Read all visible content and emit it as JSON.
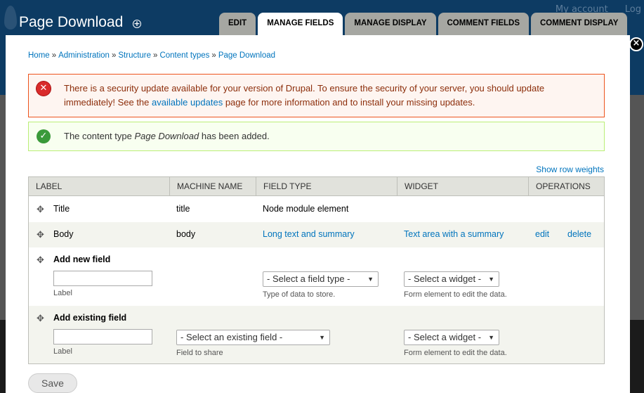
{
  "window": {
    "title": "Page Download",
    "top_links": [
      "My account",
      "Log"
    ]
  },
  "tabs": [
    {
      "label": "EDIT",
      "active": false
    },
    {
      "label": "MANAGE FIELDS",
      "active": true
    },
    {
      "label": "MANAGE DISPLAY",
      "active": false
    },
    {
      "label": "COMMENT FIELDS",
      "active": false
    },
    {
      "label": "COMMENT DISPLAY",
      "active": false
    }
  ],
  "breadcrumb": [
    "Home",
    "Administration",
    "Structure",
    "Content types",
    "Page Download"
  ],
  "messages": {
    "error": {
      "text_before": "There is a security update available for your version of Drupal. To ensure the security of your server, you should update immediately! See the ",
      "link": "available updates",
      "text_after": " page for more information and to install your missing updates."
    },
    "status": {
      "text_before": "The content type ",
      "emphasis": "Page Download",
      "text_after": " has been added."
    }
  },
  "show_row_weights": "Show row weights",
  "table": {
    "headers": [
      "LABEL",
      "MACHINE NAME",
      "FIELD TYPE",
      "WIDGET",
      "OPERATIONS"
    ],
    "rows": [
      {
        "label": "Title",
        "machine": "title",
        "type": "Node module element",
        "widget": "",
        "edit": "",
        "delete": ""
      },
      {
        "label": "Body",
        "machine": "body",
        "type": "Long text and summary",
        "widget": "Text area with a summary",
        "edit": "edit",
        "delete": "delete"
      }
    ],
    "add_new": {
      "title": "Add new field",
      "label_desc": "Label",
      "type_select": "- Select a field type -",
      "type_desc": "Type of data to store.",
      "widget_select": "- Select a widget -",
      "widget_desc": "Form element to edit the data."
    },
    "add_existing": {
      "title": "Add existing field",
      "label_desc": "Label",
      "field_select": "- Select an existing field -",
      "field_desc": "Field to share",
      "widget_select": "- Select a widget -",
      "widget_desc": "Form element to edit the data."
    }
  },
  "save_label": "Save"
}
